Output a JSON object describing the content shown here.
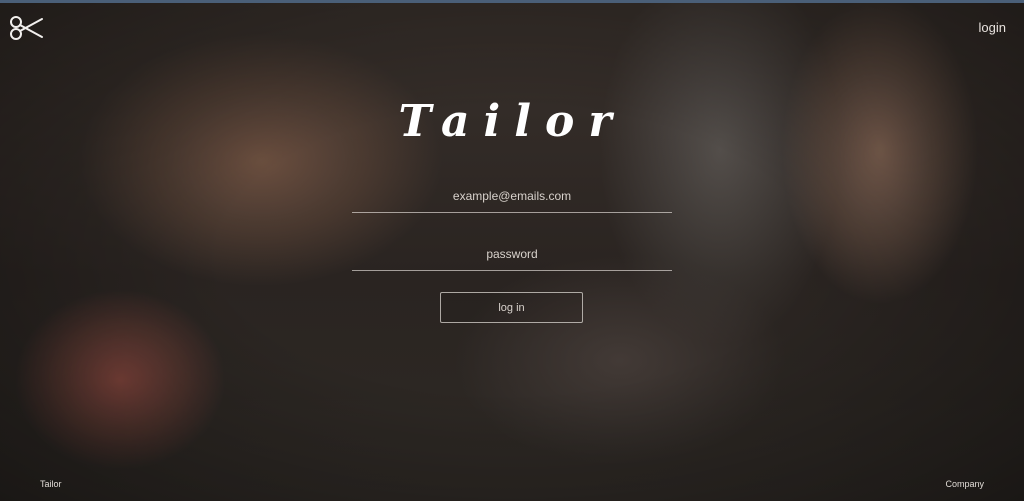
{
  "app": {
    "name": "Tailor"
  },
  "header": {
    "login_link": "login"
  },
  "hero": {
    "title": "Tailor"
  },
  "form": {
    "email_placeholder": "example@emails.com",
    "password_placeholder": "password",
    "submit_label": "log in"
  },
  "footer": {
    "left": "Tailor",
    "right": "Company"
  },
  "colors": {
    "accent_topline": "#4a5f78",
    "text": "#e8e3de"
  },
  "icons": {
    "logo": "scissors-icon"
  }
}
